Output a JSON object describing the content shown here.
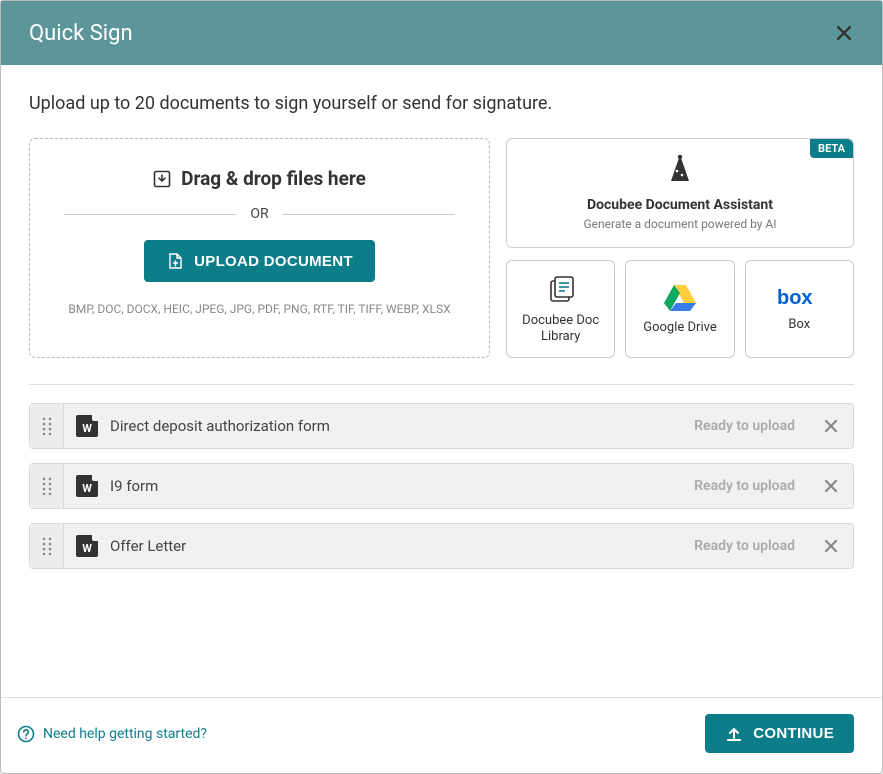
{
  "header": {
    "title": "Quick Sign"
  },
  "instruction": "Upload up to 20 documents to sign yourself or send for signature.",
  "dropzone": {
    "drag_text": "Drag & drop files here",
    "or": "OR",
    "upload_button": "UPLOAD DOCUMENT",
    "formats": "BMP, DOC, DOCX, HEIC, JPEG, JPG, PDF, PNG, RTF, TIF, TIFF, WEBP, XLSX"
  },
  "ai_card": {
    "badge": "BETA",
    "title": "Docubee Document Assistant",
    "subtitle": "Generate a document powered by AI"
  },
  "sources": [
    {
      "label": "Docubee Doc Library",
      "icon": "doc-library-icon"
    },
    {
      "label": "Google Drive",
      "icon": "google-drive-icon"
    },
    {
      "label": "Box",
      "icon": "box-icon"
    }
  ],
  "files": [
    {
      "name": "Direct deposit authorization form",
      "status": "Ready to upload",
      "type": "W"
    },
    {
      "name": "I9 form",
      "status": "Ready to upload",
      "type": "W"
    },
    {
      "name": "Offer Letter",
      "status": "Ready to upload",
      "type": "W"
    }
  ],
  "footer": {
    "help": "Need help getting started?",
    "continue": "CONTINUE"
  }
}
